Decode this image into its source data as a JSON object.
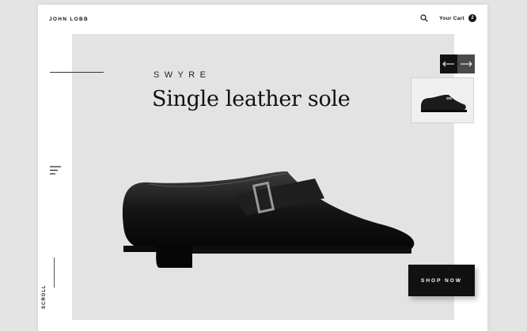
{
  "header": {
    "logo": "JOHN LOBB",
    "cart_label": "Your Cart",
    "cart_count": "2"
  },
  "hero": {
    "subtitle": "SWYRE",
    "title": "Single leather sole",
    "cta_label": "SHOP NOW"
  },
  "sidebar": {
    "scroll_label": "SCROLL"
  },
  "icons": {
    "search": "search-icon",
    "menu": "hamburger-menu-icon",
    "prev": "arrow-left-icon",
    "next": "arrow-right-icon"
  },
  "colors": {
    "accent": "#111111",
    "hero_bg": "#e3e3e3",
    "page_bg": "#ffffff"
  }
}
